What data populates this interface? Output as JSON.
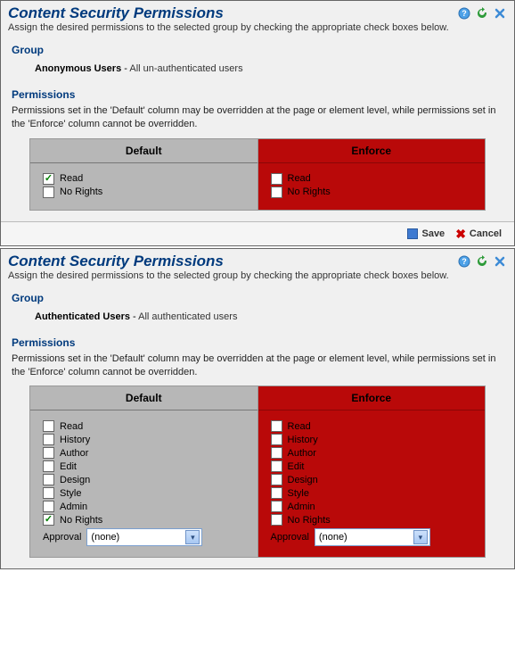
{
  "panels": [
    {
      "title": "Content Security Permissions",
      "subtitle": "Assign the desired permissions to the selected group by checking the appropriate check boxes below.",
      "group_heading": "Group",
      "group_name": "Anonymous Users",
      "group_sep": " - ",
      "group_desc": "All un-authenticated users",
      "perm_heading": "Permissions",
      "perm_desc": "Permissions set in the 'Default' column may be overridden at the page or element level, while permissions set in the 'Enforce' column cannot be overridden.",
      "default_head": "Default",
      "enforce_head": "Enforce",
      "default_items": [
        {
          "label": "Read",
          "checked": true
        },
        {
          "label": "No Rights",
          "checked": false
        }
      ],
      "enforce_items": [
        {
          "label": "Read",
          "checked": false
        },
        {
          "label": "No Rights",
          "checked": false
        }
      ],
      "has_approval": false,
      "show_footer": true,
      "save_label": "Save",
      "cancel_label": "Cancel"
    },
    {
      "title": "Content Security Permissions",
      "subtitle": "Assign the desired permissions to the selected group by checking the appropriate check boxes below.",
      "group_heading": "Group",
      "group_name": "Authenticated Users",
      "group_sep": " - ",
      "group_desc": "All authenticated users",
      "perm_heading": "Permissions",
      "perm_desc": "Permissions set in the 'Default' column may be overridden at the page or element level, while permissions set in the 'Enforce' column cannot be overridden.",
      "default_head": "Default",
      "enforce_head": "Enforce",
      "default_items": [
        {
          "label": "Read",
          "checked": false
        },
        {
          "label": "History",
          "checked": false
        },
        {
          "label": "Author",
          "checked": false
        },
        {
          "label": "Edit",
          "checked": false
        },
        {
          "label": "Design",
          "checked": false
        },
        {
          "label": "Style",
          "checked": false
        },
        {
          "label": "Admin",
          "checked": false
        },
        {
          "label": "No Rights",
          "checked": true
        }
      ],
      "enforce_items": [
        {
          "label": "Read",
          "checked": false
        },
        {
          "label": "History",
          "checked": false
        },
        {
          "label": "Author",
          "checked": false
        },
        {
          "label": "Edit",
          "checked": false
        },
        {
          "label": "Design",
          "checked": false
        },
        {
          "label": "Style",
          "checked": false
        },
        {
          "label": "Admin",
          "checked": false
        },
        {
          "label": "No Rights",
          "checked": false
        }
      ],
      "has_approval": true,
      "approval_label": "Approval",
      "approval_value": "(none)",
      "show_footer": false
    }
  ]
}
